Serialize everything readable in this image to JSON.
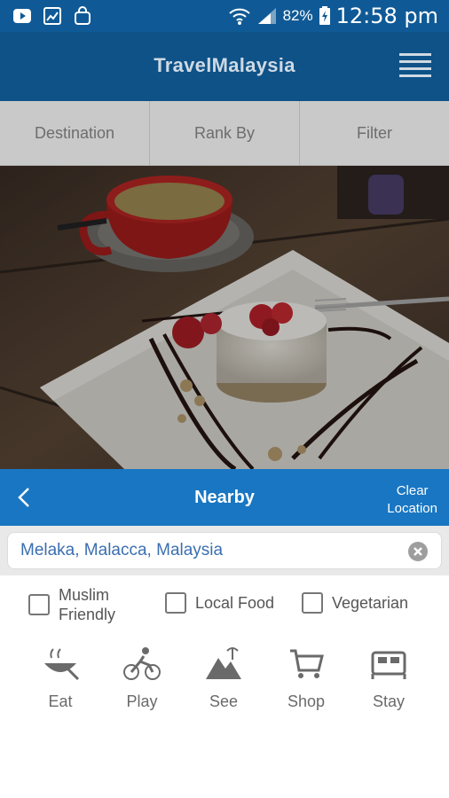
{
  "status_bar": {
    "battery_percent": "82%",
    "time": "12:58 pm",
    "left_icons": [
      "youtube-icon",
      "image-icon",
      "bag-icon"
    ],
    "right_icons": [
      "wifi-icon",
      "signal-icon",
      "battery-charging-icon"
    ]
  },
  "header": {
    "title": "TravelMalaysia",
    "menu_icon": "hamburger-menu-icon"
  },
  "sort_bar": {
    "destination": "Destination",
    "rank_by": "Rank By",
    "filter": "Filter"
  },
  "hero": {
    "description_icon": "dessert-photo"
  },
  "nearby_bar": {
    "title": "Nearby",
    "clear_line1": "Clear",
    "clear_line2": "Location",
    "back_icon": "chevron-left-icon"
  },
  "search": {
    "value": "Melaka, Malacca, Malaysia",
    "clear_icon": "clear-circle-icon"
  },
  "filters": {
    "muslim_line1": "Muslim",
    "muslim_line2": "Friendly",
    "local_food": "Local Food",
    "vegetarian": "Vegetarian"
  },
  "categories": [
    {
      "label": "Eat",
      "icon": "eat-icon"
    },
    {
      "label": "Play",
      "icon": "cycling-icon"
    },
    {
      "label": "See",
      "icon": "mountain-icon"
    },
    {
      "label": "Shop",
      "icon": "cart-icon"
    },
    {
      "label": "Stay",
      "icon": "bed-icon"
    }
  ],
  "colors": {
    "status_bar": "#0f5a96",
    "header": "#0e5288",
    "nearby_bar": "#1976c2",
    "sort_bar": "#c9c9c9",
    "search_text": "#3b6fb0"
  }
}
